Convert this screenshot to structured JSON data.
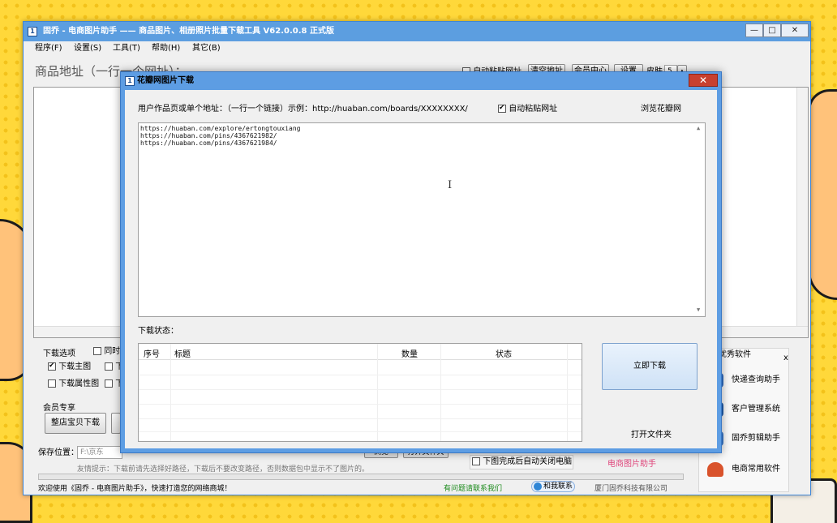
{
  "main": {
    "title": "固乔 - 电商图片助手 —— 商品图片、相册照片批量下载工具 V62.0.0.8 正式版",
    "app_icon_glyph": "1",
    "menu": [
      "程序(F)",
      "设置(S)",
      "工具(T)",
      "帮助(H)",
      "其它(B)"
    ],
    "url_label": "商品地址（一行一个网址）：",
    "auto_paste_label": "自动粘贴网址",
    "clear_button": "清空地址",
    "member_center_button": "会员中心",
    "settings_button": "设置",
    "skin_label": "皮肤：",
    "skin_value": "5",
    "download_options_label": "下载选项",
    "options": {
      "simultaneous": "同时",
      "main_image": "下载主图",
      "download_prefix": "下",
      "attribute_image": "下载属性图",
      "download_prefix2": "下"
    },
    "member_label": "会员专享",
    "whole_shop_button": "整店宝贝下载",
    "save_location_label": "保存位置：",
    "save_location_value": "F:\\京东",
    "browse_button": "浏览",
    "open_folder_button": "打开文件夹",
    "hint": "友情提示：下载前请先选择好路径，下载后不要改变路径，否则数据包中显示不了图片的。",
    "auto_shutdown_label": "下图完成后自动关闭电脑",
    "product_link": "电商图片助手",
    "status_welcome": "欢迎使用《固乔 - 电商图片助手》，快速打造您的网络商城！",
    "status_contact": "有问题请联系我们",
    "status_qq": "和我联系",
    "status_company": "厦门固乔科技有限公司"
  },
  "right_panel": {
    "title": "优秀软件",
    "close": "x",
    "items": [
      {
        "label": "快递查询助手",
        "icon": "express-icon",
        "color": "#2f6fc6"
      },
      {
        "label": "客户管理系统",
        "icon": "crm-icon",
        "color": "#1f5fb0"
      },
      {
        "label": "固乔剪辑助手",
        "icon": "video-icon",
        "color": "#3a7bd0"
      },
      {
        "label": "电商常用软件",
        "icon": "house-icon",
        "color": "#d9532c"
      }
    ]
  },
  "dialog": {
    "title": "花瓣网图片下载",
    "close_glyph": "✕",
    "instruction": "用户作品页或单个地址：（一行一个链接）示例：http://huaban.com/boards/XXXXXXXX/",
    "auto_paste_label": "自动粘贴网址",
    "auto_paste_checked": true,
    "browse_link": "浏览花瓣网",
    "urls": [
      "https://huaban.com/explore/ertongtouxiang",
      "https://huaban.com/pins/4367621982/",
      "https://huaban.com/pins/4367621984/"
    ],
    "status_label": "下载状态：",
    "columns": [
      "序号",
      "标题",
      "数量",
      "状态"
    ],
    "download_button": "立即下载",
    "open_folder": "打开文件夹"
  }
}
